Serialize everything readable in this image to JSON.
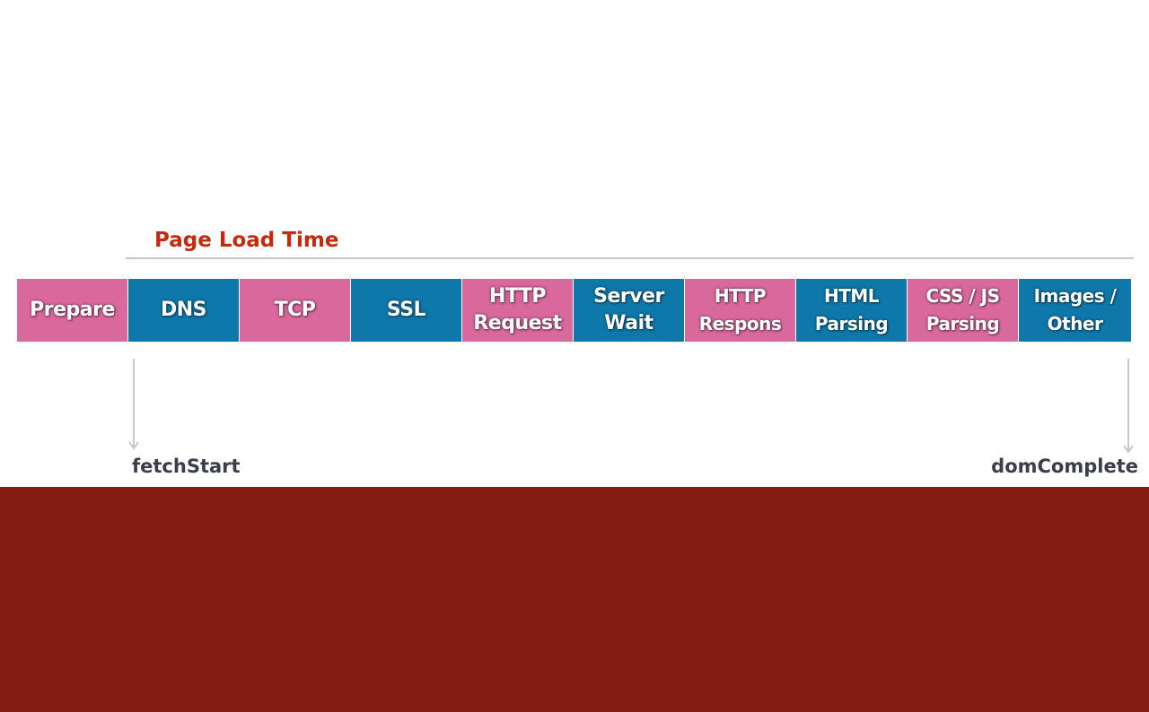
{
  "diagram": {
    "title": "Page Load Time",
    "segments": [
      {
        "label": "Prepare",
        "color": "#d9689c"
      },
      {
        "label": "DNS",
        "color": "#0e78aa"
      },
      {
        "label": "TCP",
        "color": "#d9689c"
      },
      {
        "label": "SSL",
        "color": "#0e78aa"
      },
      {
        "label": "HTTP\nRequest",
        "color": "#d9689c"
      },
      {
        "label": "Server\nWait",
        "color": "#0e78aa"
      },
      {
        "label": "HTTP\nRespons",
        "color": "#d9689c"
      },
      {
        "label": "HTML\nParsing",
        "color": "#0e78aa"
      },
      {
        "label": "CSS / JS\nParsing",
        "color": "#d9689c"
      },
      {
        "label": "Images /\nOther",
        "color": "#0e78aa"
      }
    ],
    "start_marker": "fetchStart",
    "end_marker": "domComplete"
  },
  "colors": {
    "title": "#c32a0e",
    "pink": "#d9689c",
    "blue": "#0e78aa",
    "footer_band": "#841c12",
    "marker_text": "#3a3d4a"
  }
}
